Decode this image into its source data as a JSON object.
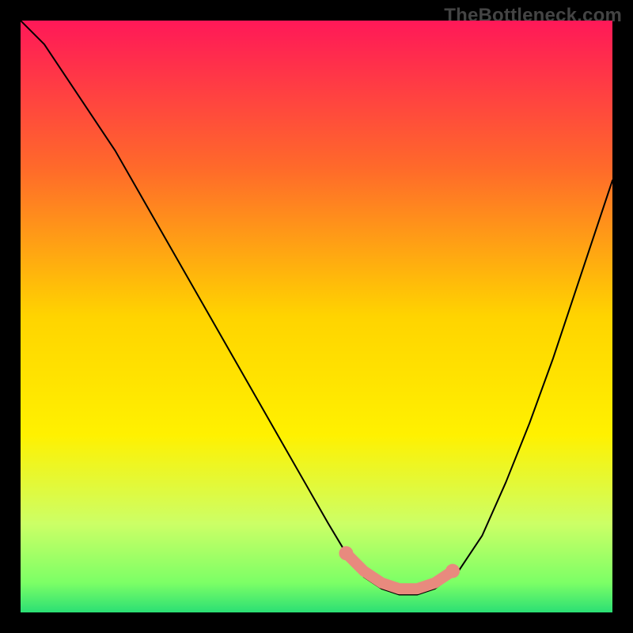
{
  "watermark": {
    "text": "TheBottleneck.com"
  },
  "chart_data": {
    "type": "line",
    "title": "",
    "xlabel": "",
    "ylabel": "",
    "xlim": [
      0,
      100
    ],
    "ylim": [
      0,
      100
    ],
    "grid": false,
    "legend": false,
    "gradient_stops": [
      {
        "offset": 0.0,
        "color": "#ff1858"
      },
      {
        "offset": 0.25,
        "color": "#ff6a2a"
      },
      {
        "offset": 0.5,
        "color": "#ffd400"
      },
      {
        "offset": 0.7,
        "color": "#fff100"
      },
      {
        "offset": 0.85,
        "color": "#ccff66"
      },
      {
        "offset": 0.95,
        "color": "#7cff66"
      },
      {
        "offset": 1.0,
        "color": "#2bdf74"
      }
    ],
    "series": [
      {
        "name": "bottleneck-curve",
        "color": "#000000",
        "x": [
          0,
          4,
          8,
          12,
          16,
          20,
          24,
          28,
          32,
          36,
          40,
          44,
          48,
          52,
          55,
          58,
          61,
          64,
          67,
          70,
          74,
          78,
          82,
          86,
          90,
          94,
          98,
          100
        ],
        "y": [
          100,
          96,
          90,
          84,
          78,
          71,
          64,
          57,
          50,
          43,
          36,
          29,
          22,
          15,
          10,
          6,
          4,
          3,
          3,
          4,
          7,
          13,
          22,
          32,
          43,
          55,
          67,
          73
        ]
      }
    ],
    "highlight_band": {
      "name": "optimal-zone",
      "color": "#e88a7e",
      "x": [
        55,
        58,
        61,
        64,
        67,
        70,
        73
      ],
      "y": [
        10,
        7,
        5,
        4,
        4,
        5,
        7
      ],
      "marker_radius_percent": 1.2
    }
  }
}
